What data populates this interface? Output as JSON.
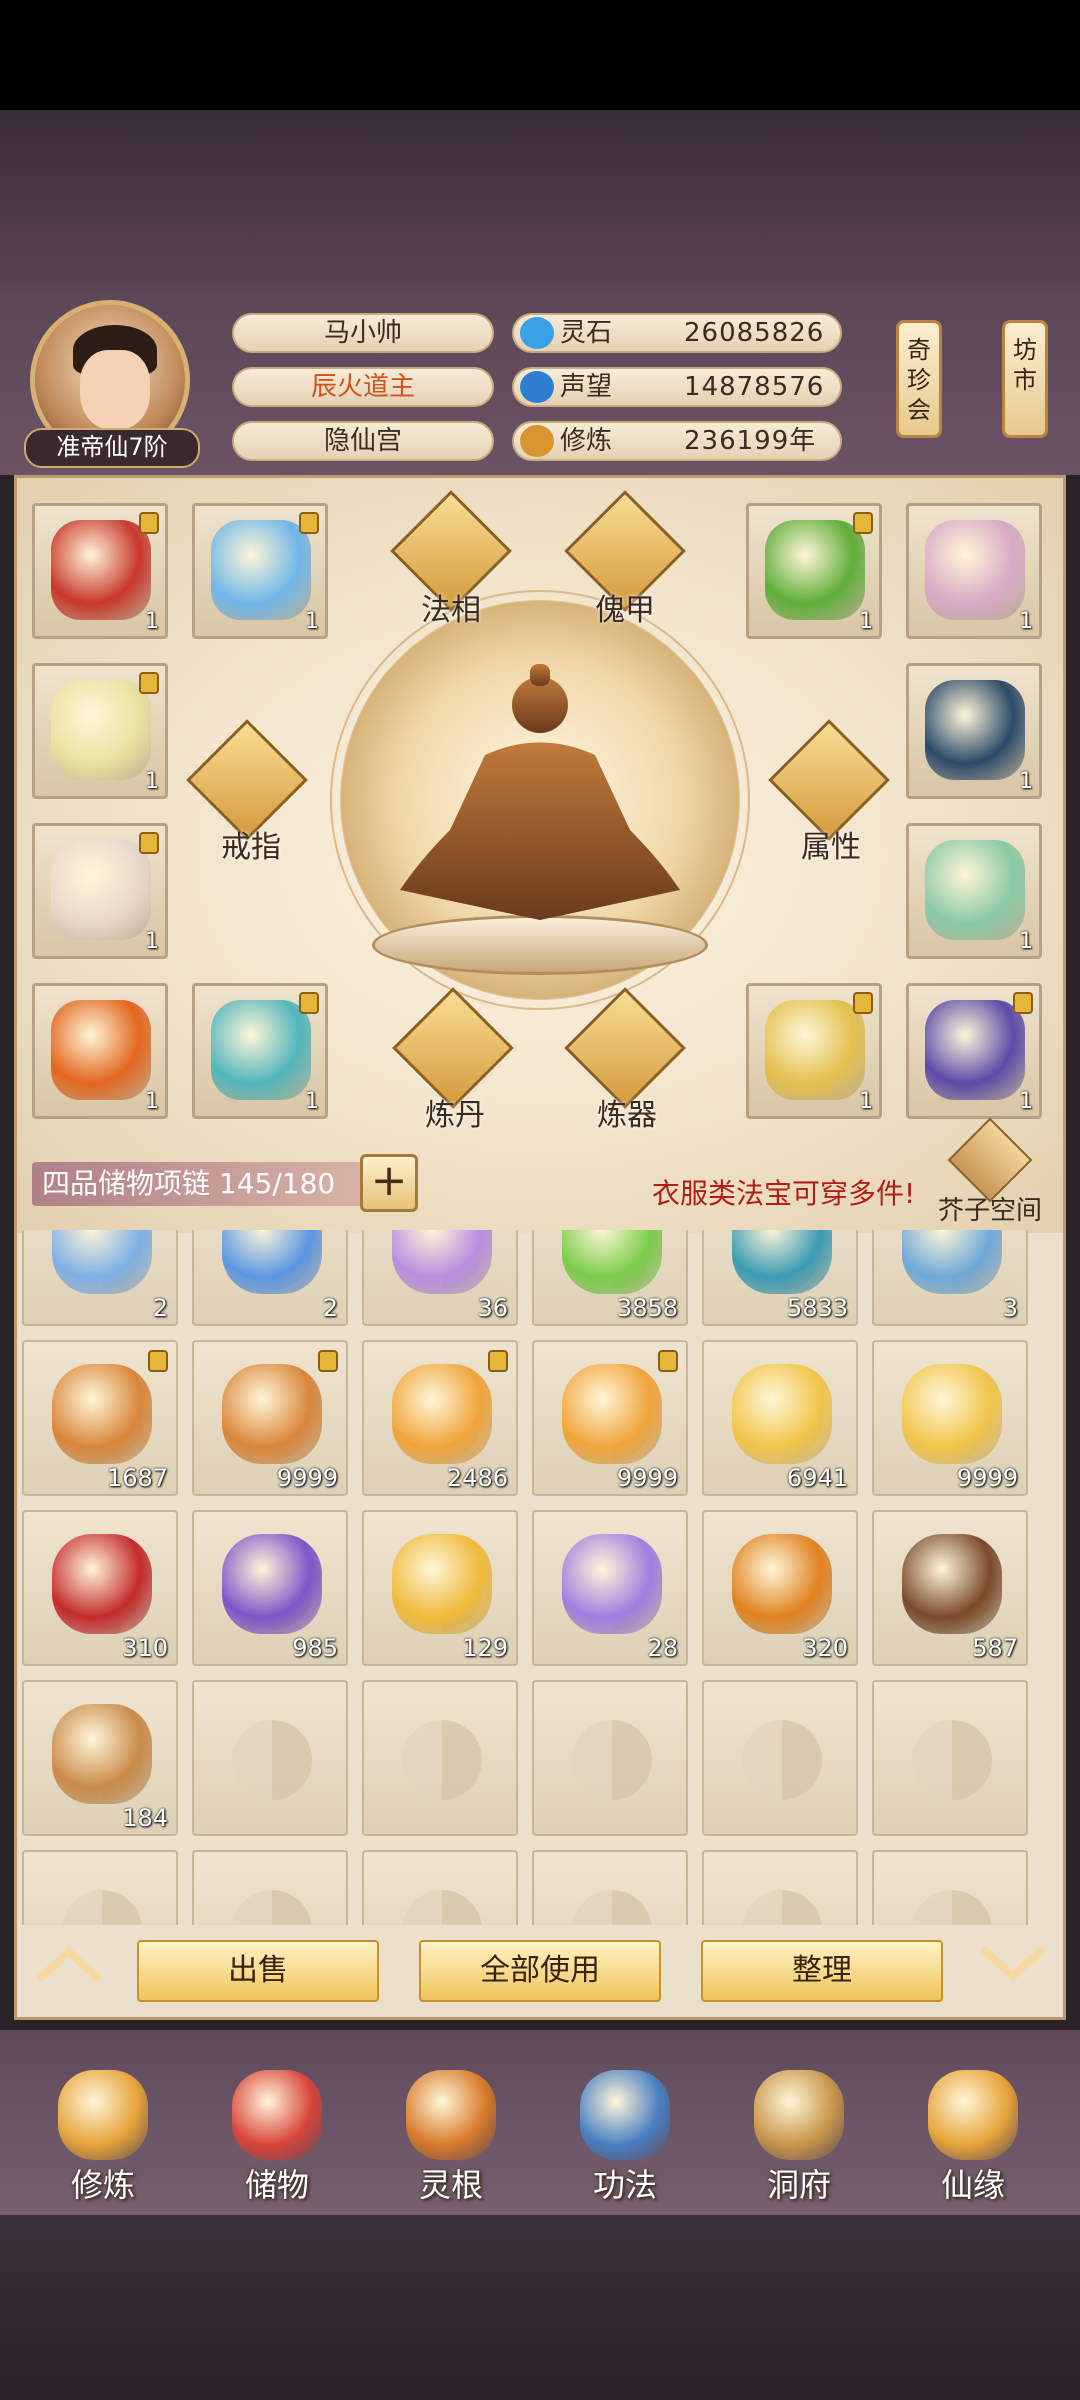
{
  "player": {
    "name": "马小帅",
    "title": "辰火道主",
    "sect": "隐仙宫",
    "rank": "准帝仙7阶"
  },
  "resources": [
    {
      "label": "灵石",
      "value": "26085826",
      "icon": "spirit-stone-icon",
      "color": "#3aa0e8"
    },
    {
      "label": "声望",
      "value": "14878576",
      "icon": "prestige-icon",
      "color": "#2e7fd1"
    },
    {
      "label": "修炼",
      "value": "236199年",
      "icon": "cultivation-icon",
      "color": "#d9962e"
    }
  ],
  "side_buttons": [
    {
      "label": "奇珍会"
    },
    {
      "label": "坊市"
    }
  ],
  "equip_actions": {
    "faxiang": "法相",
    "kuijia": "傀甲",
    "jiezhi": "戒指",
    "shuxing": "属性",
    "liandan": "炼丹",
    "lianqi": "炼器"
  },
  "equip_slots": [
    {
      "count": "1",
      "locked": true,
      "color": "#c8372b"
    },
    {
      "count": "1",
      "locked": true,
      "color": "#6fb7e8"
    },
    {
      "count": "1",
      "locked": true,
      "color": "#5fae3a"
    },
    {
      "count": "1",
      "locked": false,
      "color": "#d8a9c6"
    },
    {
      "count": "1",
      "locked": true,
      "color": "#e8e2a0"
    },
    {
      "count": "1",
      "locked": false,
      "color": "#2b4a6a"
    },
    {
      "count": "1",
      "locked": true,
      "color": "#e7d8cc"
    },
    {
      "count": "1",
      "locked": false,
      "color": "#8ac9a6"
    },
    {
      "count": "1",
      "locked": false,
      "color": "#e2651d"
    },
    {
      "count": "1",
      "locked": true,
      "color": "#52b6bd"
    },
    {
      "count": "1",
      "locked": true,
      "color": "#e3c04e"
    },
    {
      "count": "1",
      "locked": true,
      "color": "#5c4aa8"
    }
  ],
  "storage": {
    "bag_label": "四品储物项链 145/180",
    "tip": "衣服类法宝可穿多件!",
    "jiezi_label": "芥子空间"
  },
  "items": [
    {
      "count": "2",
      "locked": false,
      "color": "#7fb0e6",
      "empty": false
    },
    {
      "count": "2",
      "locked": false,
      "color": "#5b96e3",
      "empty": false
    },
    {
      "count": "36",
      "locked": false,
      "color": "#b98ee0",
      "empty": false
    },
    {
      "count": "3858",
      "locked": false,
      "color": "#7ccd4a",
      "empty": false
    },
    {
      "count": "5833",
      "locked": false,
      "color": "#3a9bb4",
      "empty": false
    },
    {
      "count": "3",
      "locked": false,
      "color": "#6fa9d8",
      "empty": false
    },
    {
      "count": "1687",
      "locked": true,
      "color": "#d9863a",
      "empty": false
    },
    {
      "count": "9999",
      "locked": true,
      "color": "#d9863a",
      "empty": false
    },
    {
      "count": "2486",
      "locked": true,
      "color": "#f0a43a",
      "empty": false
    },
    {
      "count": "9999",
      "locked": true,
      "color": "#f0a43a",
      "empty": false
    },
    {
      "count": "6941",
      "locked": false,
      "color": "#f1c54a",
      "empty": false
    },
    {
      "count": "9999",
      "locked": false,
      "color": "#f1c54a",
      "empty": false
    },
    {
      "count": "310",
      "locked": false,
      "color": "#c42b2b",
      "empty": false
    },
    {
      "count": "985",
      "locked": false,
      "color": "#7d55c9",
      "empty": false
    },
    {
      "count": "129",
      "locked": false,
      "color": "#f0b93a",
      "empty": false
    },
    {
      "count": "28",
      "locked": false,
      "color": "#9d7fe0",
      "empty": false
    },
    {
      "count": "320",
      "locked": false,
      "color": "#e0821f",
      "empty": false
    },
    {
      "count": "587",
      "locked": false,
      "color": "#7a4a2a",
      "empty": false
    },
    {
      "count": "184",
      "locked": false,
      "color": "#c98a4a",
      "empty": false
    },
    {
      "count": "",
      "locked": false,
      "color": "",
      "empty": true
    },
    {
      "count": "",
      "locked": false,
      "color": "",
      "empty": true
    },
    {
      "count": "",
      "locked": false,
      "color": "",
      "empty": true
    },
    {
      "count": "",
      "locked": false,
      "color": "",
      "empty": true
    },
    {
      "count": "",
      "locked": false,
      "color": "",
      "empty": true
    },
    {
      "count": "",
      "locked": false,
      "color": "",
      "empty": true
    },
    {
      "count": "",
      "locked": false,
      "color": "",
      "empty": true
    },
    {
      "count": "",
      "locked": false,
      "color": "",
      "empty": true
    },
    {
      "count": "",
      "locked": false,
      "color": "",
      "empty": true
    },
    {
      "count": "",
      "locked": false,
      "color": "",
      "empty": true
    },
    {
      "count": "",
      "locked": false,
      "color": "",
      "empty": true
    }
  ],
  "actions": {
    "sell": "出售",
    "use_all": "全部使用",
    "sort": "整理"
  },
  "nav": [
    {
      "label": "修炼",
      "icon": "cultivate-icon",
      "color": "#e6a33a"
    },
    {
      "label": "储物",
      "icon": "storage-bag-icon",
      "color": "#d8453b"
    },
    {
      "label": "灵根",
      "icon": "spirit-root-icon",
      "color": "#d87a2a"
    },
    {
      "label": "功法",
      "icon": "technique-book-icon",
      "color": "#4a7fc1"
    },
    {
      "label": "洞府",
      "icon": "cave-house-icon",
      "color": "#c8954a"
    },
    {
      "label": "仙缘",
      "icon": "fortune-gourd-icon",
      "color": "#e6a33a"
    }
  ],
  "colors": {
    "accent_title": "#d0531a",
    "tip_red": "#b21d16",
    "gold": "#f1c35d"
  }
}
